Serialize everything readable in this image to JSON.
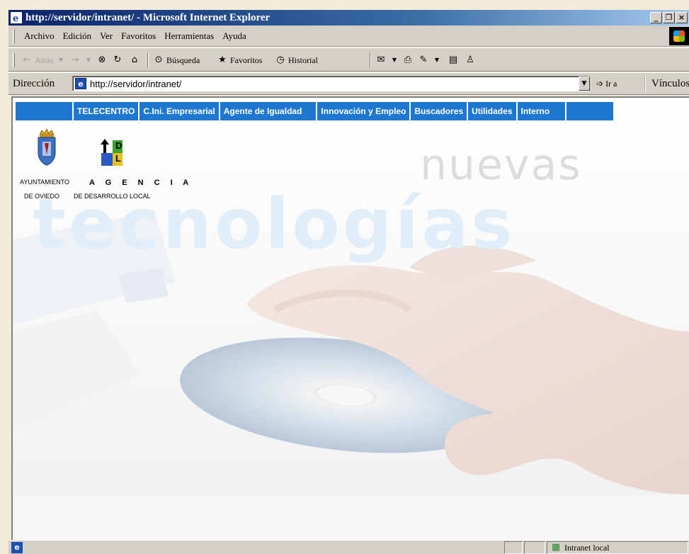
{
  "window": {
    "title": "http://servidor/intranet/ - Microsoft Internet Explorer"
  },
  "menu": [
    "Archivo",
    "Edición",
    "Ver",
    "Favoritos",
    "Herramientas",
    "Ayuda"
  ],
  "toolbar": {
    "back": "Atrás",
    "search": "Búsqueda",
    "favorites": "Favoritos",
    "history": "Historial"
  },
  "address": {
    "label": "Dirección",
    "url": "http://servidor/intranet/",
    "go": "Ir a",
    "links": "Vínculos"
  },
  "nav": [
    "TELECENTRO",
    "C.Ini. Empresarial",
    "Agente de Igualdad",
    "Innovación y Empleo",
    "Buscadores",
    "Utilidades",
    "Interno"
  ],
  "logos": {
    "ayuntamiento_line1": "AYUNTAMIENTO",
    "ayuntamiento_line2": "DE OVIEDO",
    "agencia_title": "A G E N C I A",
    "agencia_sub": "DE DESARROLLO LOCAL",
    "adl_letters": [
      "D",
      "L"
    ]
  },
  "hero": {
    "word1": "nuevas",
    "word2": "tecnologías"
  },
  "status": {
    "zone": "Intranet local"
  },
  "colors": {
    "nav_blue": "#1e78d2",
    "title_blue": "#0a246a"
  }
}
